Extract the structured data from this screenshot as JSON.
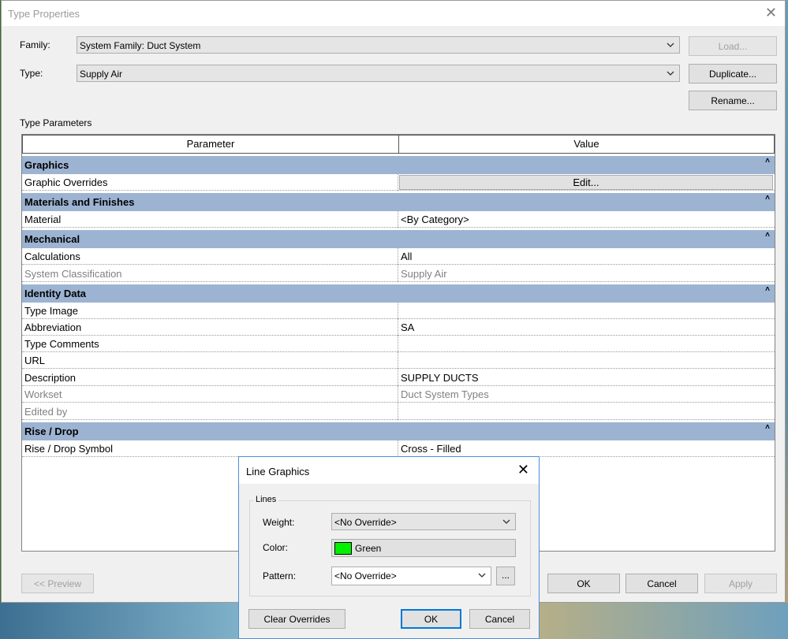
{
  "window": {
    "title": "Type Properties",
    "close": "✕"
  },
  "family": {
    "label": "Family:",
    "value": "System Family: Duct System"
  },
  "type": {
    "label": "Type:",
    "value": "Supply Air"
  },
  "buttons": {
    "load": "Load...",
    "duplicate": "Duplicate...",
    "rename": "Rename...",
    "preview": "<< Preview",
    "ok": "OK",
    "cancel": "Cancel",
    "apply": "Apply"
  },
  "type_parameters_label": "Type Parameters",
  "table": {
    "col_parameter": "Parameter",
    "col_value": "Value",
    "groups": {
      "graphics": "Graphics",
      "materials": "Materials and Finishes",
      "mechanical": "Mechanical",
      "identity": "Identity Data",
      "rise": "Rise / Drop"
    },
    "collapse_icon": "˄",
    "rows": {
      "graphic_overrides": {
        "param": "Graphic Overrides",
        "value": "Edit..."
      },
      "material": {
        "param": "Material",
        "value": "<By Category>"
      },
      "calculations": {
        "param": "Calculations",
        "value": "All"
      },
      "system_classification": {
        "param": "System Classification",
        "value": "Supply Air"
      },
      "type_image": {
        "param": "Type Image",
        "value": ""
      },
      "abbreviation": {
        "param": "Abbreviation",
        "value": "SA"
      },
      "type_comments": {
        "param": "Type Comments",
        "value": ""
      },
      "url": {
        "param": "URL",
        "value": ""
      },
      "description": {
        "param": "Description",
        "value": "SUPPLY DUCTS"
      },
      "workset": {
        "param": "Workset",
        "value": "Duct System Types"
      },
      "edited_by": {
        "param": "Edited by",
        "value": ""
      },
      "rise_drop_symbol": {
        "param": "Rise / Drop Symbol",
        "value": "Cross - Filled"
      }
    }
  },
  "line_graphics": {
    "title": "Line Graphics",
    "close": "✕",
    "group_label": "Lines",
    "weight_label": "Weight:",
    "weight_value": "<No Override>",
    "color_label": "Color:",
    "color_value": "Green",
    "color_hex": "#00f000",
    "pattern_label": "Pattern:",
    "pattern_value": "<No Override>",
    "pattern_browse": "...",
    "clear_overrides": "Clear Overrides",
    "ok": "OK",
    "cancel": "Cancel"
  }
}
